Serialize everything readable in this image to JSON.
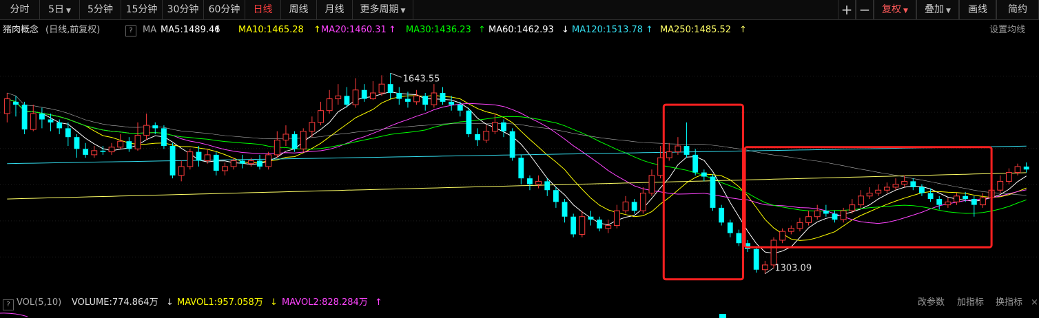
{
  "toolbar": {
    "items": [
      {
        "label": "分时",
        "active": false,
        "caret": false
      },
      {
        "label": "5日",
        "active": false,
        "caret": true
      },
      {
        "label": "5分钟",
        "active": false,
        "caret": false
      },
      {
        "label": "15分钟",
        "active": false,
        "caret": false
      },
      {
        "label": "30分钟",
        "active": false,
        "caret": false
      },
      {
        "label": "60分钟",
        "active": false,
        "caret": false
      },
      {
        "label": "日线",
        "active": true,
        "caret": false
      },
      {
        "label": "周线",
        "active": false,
        "caret": false
      },
      {
        "label": "月线",
        "active": false,
        "caret": false
      },
      {
        "label": "更多周期",
        "active": false,
        "caret": true
      }
    ],
    "right": {
      "zoom_in": "+",
      "zoom_out": "−",
      "fuquan": "复权",
      "overlay": "叠加",
      "draw": "画线",
      "simple": "简约"
    }
  },
  "info": {
    "name": "猪肉概念",
    "mode": "(日线,前复权)",
    "help": "?",
    "ma_label": "MA",
    "ma": [
      {
        "text": "MA5:1489.46",
        "arrow": "↑",
        "color": "#ffffff"
      },
      {
        "text": "MA10:1465.28",
        "arrow": "↑",
        "color": "#ffff00"
      },
      {
        "text": "MA20:1460.31",
        "arrow": "↑",
        "color": "#ff44ff"
      },
      {
        "text": "MA30:1436.23",
        "arrow": "↑",
        "color": "#00ff00"
      },
      {
        "text": "MA60:1462.93",
        "arrow": "↓",
        "color": "#ffffff"
      },
      {
        "text": "MA120:1513.78",
        "arrow": "↑",
        "color": "#33ddee"
      },
      {
        "text": "MA250:1485.52",
        "arrow": "↑",
        "color": "#ffff66"
      }
    ],
    "settings": "设置均线"
  },
  "annotations": {
    "high": "1643.55",
    "low": "1303.09"
  },
  "volume": {
    "help": "?",
    "title": "VOL(5,10)",
    "volume": "VOLUME:774.864万",
    "volume_arrow": "↓",
    "mavol1": "MAVOL1:957.058万",
    "mavol1_arrow": "↓",
    "mavol2": "MAVOL2:828.284万",
    "mavol2_arrow": "↑",
    "btn_params": "改参数",
    "btn_add": "加指标",
    "btn_switch": "换指标"
  },
  "colors": {
    "up": "#ff3c3c",
    "down": "#00ffff",
    "highlight_box": "#ff2020",
    "grid": "#1e1e1e",
    "ma5": "#ffffff",
    "ma10": "#ffff00",
    "ma20": "#ff44ff",
    "ma30": "#00ff00",
    "ma60": "#ffffff",
    "ma120": "#33ddee",
    "ma250": "#ffff66"
  },
  "chart_data": {
    "type": "candlestick",
    "y_range": [
      1270,
      1700
    ],
    "candles": [
      [
        1575,
        1600,
        1610,
        1560
      ],
      [
        1595,
        1590,
        1605,
        1570
      ],
      [
        1590,
        1548,
        1595,
        1540
      ],
      [
        1548,
        1575,
        1590,
        1545
      ],
      [
        1575,
        1565,
        1585,
        1550
      ],
      [
        1565,
        1560,
        1575,
        1545
      ],
      [
        1560,
        1550,
        1565,
        1540
      ],
      [
        1550,
        1535,
        1560,
        1520
      ],
      [
        1535,
        1515,
        1540,
        1500
      ],
      [
        1515,
        1505,
        1525,
        1500
      ],
      [
        1505,
        1512,
        1520,
        1500
      ],
      [
        1512,
        1510,
        1520,
        1505
      ],
      [
        1510,
        1518,
        1525,
        1505
      ],
      [
        1518,
        1528,
        1540,
        1515
      ],
      [
        1528,
        1515,
        1535,
        1510
      ],
      [
        1515,
        1538,
        1560,
        1512
      ],
      [
        1538,
        1555,
        1575,
        1530
      ],
      [
        1555,
        1550,
        1560,
        1540
      ],
      [
        1550,
        1520,
        1555,
        1515
      ],
      [
        1520,
        1470,
        1525,
        1465
      ],
      [
        1470,
        1485,
        1495,
        1460
      ],
      [
        1485,
        1510,
        1515,
        1480
      ],
      [
        1510,
        1495,
        1520,
        1485
      ],
      [
        1495,
        1505,
        1515,
        1490
      ],
      [
        1505,
        1478,
        1510,
        1470
      ],
      [
        1478,
        1485,
        1492,
        1470
      ],
      [
        1485,
        1495,
        1500,
        1480
      ],
      [
        1495,
        1490,
        1505,
        1482
      ],
      [
        1490,
        1495,
        1500,
        1485
      ],
      [
        1495,
        1485,
        1505,
        1480
      ],
      [
        1485,
        1505,
        1510,
        1480
      ],
      [
        1505,
        1530,
        1545,
        1500
      ],
      [
        1530,
        1540,
        1555,
        1520
      ],
      [
        1540,
        1515,
        1545,
        1510
      ],
      [
        1515,
        1545,
        1550,
        1510
      ],
      [
        1545,
        1560,
        1570,
        1535
      ],
      [
        1560,
        1580,
        1595,
        1555
      ],
      [
        1580,
        1600,
        1615,
        1575
      ],
      [
        1600,
        1605,
        1625,
        1590
      ],
      [
        1605,
        1590,
        1620,
        1585
      ],
      [
        1590,
        1615,
        1635,
        1585
      ],
      [
        1615,
        1600,
        1625,
        1595
      ],
      [
        1600,
        1610,
        1630,
        1598
      ],
      [
        1610,
        1625,
        1640,
        1605
      ],
      [
        1625,
        1610,
        1643.55,
        1600
      ],
      [
        1610,
        1600,
        1620,
        1590
      ],
      [
        1600,
        1595,
        1612,
        1585
      ],
      [
        1595,
        1605,
        1615,
        1590
      ],
      [
        1605,
        1590,
        1610,
        1580
      ],
      [
        1590,
        1610,
        1625,
        1585
      ],
      [
        1610,
        1595,
        1620,
        1590
      ],
      [
        1595,
        1590,
        1605,
        1580
      ],
      [
        1590,
        1580,
        1595,
        1570
      ],
      [
        1580,
        1540,
        1585,
        1535
      ],
      [
        1540,
        1530,
        1550,
        1520
      ],
      [
        1530,
        1545,
        1555,
        1525
      ],
      [
        1545,
        1560,
        1575,
        1540
      ],
      [
        1560,
        1545,
        1565,
        1535
      ],
      [
        1545,
        1500,
        1550,
        1495
      ],
      [
        1500,
        1465,
        1505,
        1455
      ],
      [
        1465,
        1455,
        1470,
        1445
      ],
      [
        1455,
        1460,
        1470,
        1448
      ],
      [
        1460,
        1445,
        1465,
        1435
      ],
      [
        1445,
        1425,
        1450,
        1415
      ],
      [
        1425,
        1400,
        1430,
        1390
      ],
      [
        1400,
        1370,
        1405,
        1365
      ],
      [
        1370,
        1400,
        1410,
        1365
      ],
      [
        1400,
        1395,
        1410,
        1385
      ],
      [
        1395,
        1380,
        1400,
        1375
      ],
      [
        1380,
        1385,
        1395,
        1372
      ],
      [
        1385,
        1410,
        1420,
        1380
      ],
      [
        1410,
        1425,
        1435,
        1405
      ],
      [
        1425,
        1410,
        1430,
        1405
      ],
      [
        1410,
        1440,
        1450,
        1405
      ],
      [
        1440,
        1470,
        1480,
        1435
      ],
      [
        1470,
        1500,
        1520,
        1465
      ],
      [
        1500,
        1510,
        1525,
        1495
      ],
      [
        1510,
        1520,
        1535,
        1505
      ],
      [
        1520,
        1505,
        1560,
        1500
      ],
      [
        1505,
        1475,
        1515,
        1470
      ],
      [
        1475,
        1468,
        1480,
        1460
      ],
      [
        1468,
        1415,
        1472,
        1410
      ],
      [
        1415,
        1390,
        1420,
        1385
      ],
      [
        1390,
        1372,
        1395,
        1365
      ],
      [
        1372,
        1355,
        1378,
        1350
      ],
      [
        1355,
        1345,
        1360,
        1340
      ],
      [
        1345,
        1310,
        1350,
        1305
      ],
      [
        1310,
        1318,
        1325,
        1303.09
      ],
      [
        1318,
        1360,
        1365,
        1312
      ],
      [
        1360,
        1375,
        1380,
        1355
      ],
      [
        1375,
        1380,
        1385,
        1370
      ],
      [
        1380,
        1390,
        1398,
        1375
      ],
      [
        1390,
        1400,
        1410,
        1385
      ],
      [
        1400,
        1410,
        1420,
        1395
      ],
      [
        1410,
        1405,
        1420,
        1400
      ],
      [
        1405,
        1395,
        1410,
        1390
      ],
      [
        1395,
        1410,
        1415,
        1390
      ],
      [
        1410,
        1420,
        1430,
        1405
      ],
      [
        1420,
        1435,
        1445,
        1415
      ],
      [
        1435,
        1440,
        1450,
        1430
      ],
      [
        1440,
        1445,
        1455,
        1435
      ],
      [
        1445,
        1450,
        1458,
        1440
      ],
      [
        1450,
        1455,
        1465,
        1445
      ],
      [
        1455,
        1460,
        1470,
        1450
      ],
      [
        1460,
        1450,
        1465,
        1445
      ],
      [
        1450,
        1440,
        1455,
        1435
      ],
      [
        1440,
        1430,
        1448,
        1425
      ],
      [
        1430,
        1420,
        1435,
        1412
      ],
      [
        1420,
        1425,
        1432,
        1415
      ],
      [
        1425,
        1435,
        1440,
        1420
      ],
      [
        1435,
        1430,
        1442,
        1425
      ],
      [
        1430,
        1420,
        1435,
        1400
      ],
      [
        1420,
        1432,
        1440,
        1415
      ],
      [
        1432,
        1445,
        1455,
        1428
      ],
      [
        1445,
        1460,
        1470,
        1440
      ],
      [
        1460,
        1475,
        1482,
        1455
      ],
      [
        1475,
        1485,
        1490,
        1470
      ],
      [
        1485,
        1480,
        1492,
        1475
      ]
    ]
  }
}
